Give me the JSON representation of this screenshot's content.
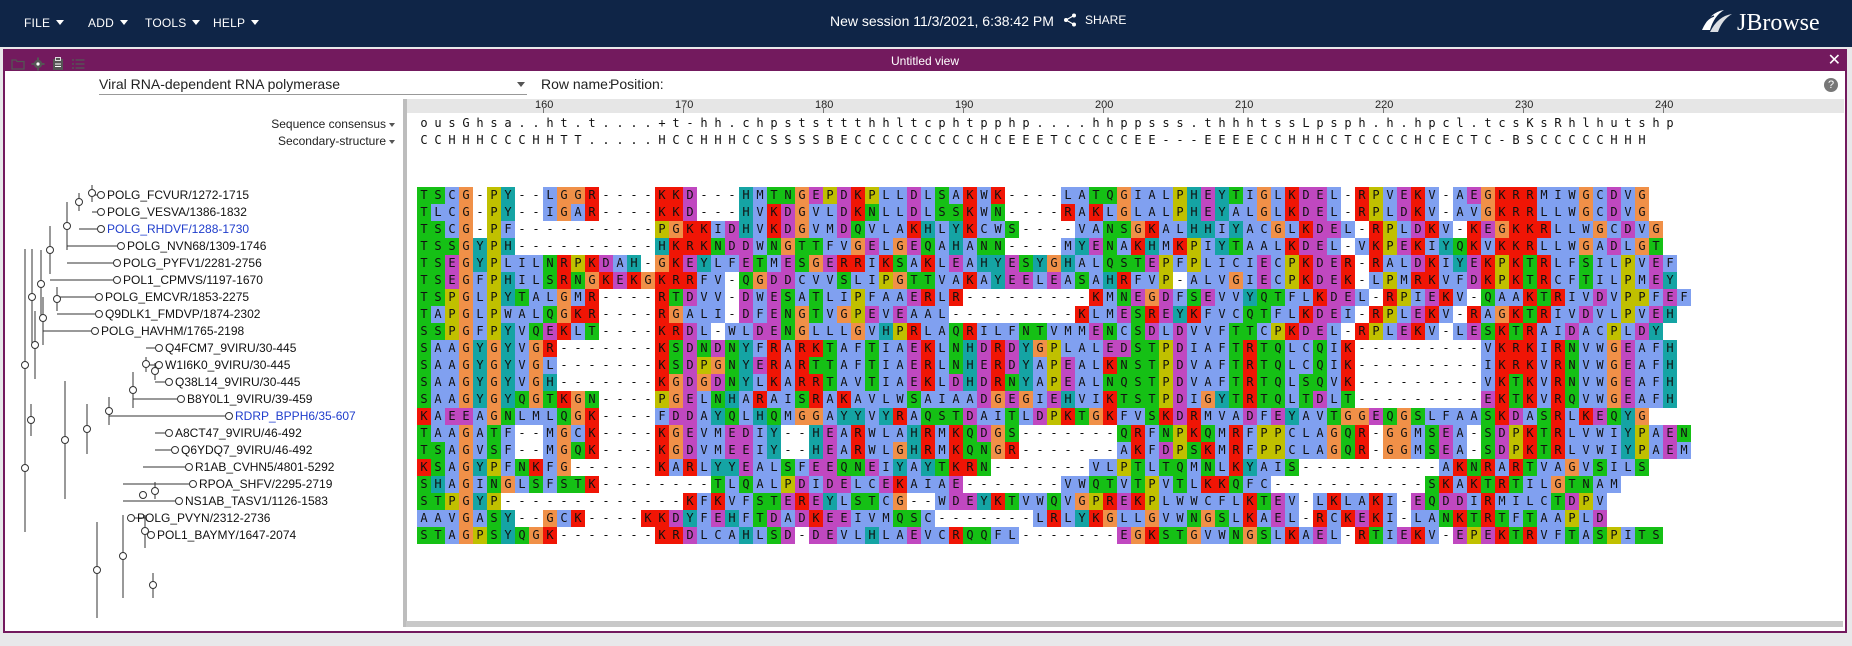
{
  "menu": [
    {
      "label": "FILE",
      "id": "file"
    },
    {
      "label": "ADD",
      "id": "add"
    },
    {
      "label": "TOOLS",
      "id": "tools"
    },
    {
      "label": "HELP",
      "id": "help"
    }
  ],
  "session": {
    "title": "New session 11/3/2021, 6:38:42 PM",
    "share_label": "SHARE"
  },
  "logo": {
    "text": "JBrowse"
  },
  "view": {
    "title": "Untitled view",
    "close": "✕",
    "dataset": "Viral RNA-dependent RNA polymerase",
    "row_name_label": "Row name:",
    "position_label": "Position:",
    "help": "?"
  },
  "ruler": {
    "ticks": [
      "160",
      "170",
      "180",
      "190",
      "200",
      "210",
      "220",
      "230",
      "240"
    ],
    "tick_columns": [
      9,
      19,
      29,
      39,
      49,
      59,
      69,
      79,
      89
    ]
  },
  "tracks": [
    {
      "name": "Sequence consensus",
      "row": "ousGhsa..ht.t....+t-hh.chpststtthhltcphtpphp....hhppsss.thhhtssLpsph.h.hpcl.tcsKsRhlhutshp"
    },
    {
      "name": "Secondary-structure",
      "row": "CCHHHCCCHHTT.....HCCHHHCCSSSSBECCCCCCCCCHCEEETCCCCCEE---EEEECCHHHCTCCCCHCECTC-BSCCCCCHHH"
    }
  ],
  "sequences": [
    {
      "name": "POLG_FCVUR/1272-1715",
      "highlight": false,
      "seq": "TSCG-PY--LGGR----KKD---HMTNGEPDKPLLDLSAKWK----LATQGIALPHEYTIGLKDEL-RPVEKV-AEGKRRMIWGCDVG"
    },
    {
      "name": "POLG_VESVA/1386-1832",
      "highlight": false,
      "seq": "TLCG-PY--IGAR----KKD---HVKDGVLDKNLLDLSSKWN----RAKLGLALPHEYALGLKDEL-RPLDKV-AVGKRRLLWGCDVG"
    },
    {
      "name": "POLG_RHDVF/1288-1730",
      "highlight": true,
      "seq": "TSCG-PF----------PGKKIDHVKDGVMDQVLAKHLYKCWS----VANSGKALHHIYACGLKDEL-RPLDKV-KEGKKRLLWGCDVG"
    },
    {
      "name": "POLG_NVN68/1309-1746",
      "highlight": false,
      "seq": "TSSGYPH----------HKRKNDDWNGTTFVGELGEQAHANN----MYENAKHMKPIYTAALKDEL-VKPEKIYQKVKKRLLWGADLGT"
    },
    {
      "name": "POLG_PYFV1/2281-2756",
      "highlight": false,
      "seq": "TSEGYPLILNRPKDAH-GKEYLFETMESGERRIKSAKLEAHYESYGHALQSTEPFPLICIECPKDER-RALDKIYEKPKTRLFSILPVEF"
    },
    {
      "name": "POL1_CPMVS/1197-1670",
      "highlight": false,
      "seq": "TSEGFPHILSRNGKEKGKRRFV-QGDDCVVSLIPGTTVAKAYEELEASAHRFVP-ALVGIECPKDEK-LPMRKVFDKPKTRCFTILPMEY"
    },
    {
      "name": "POLG_EMCVR/1853-2275",
      "highlight": false,
      "seq": "TSPGLPYTALGMR----RTDVV-DWESATLIPFAAERLR---------KMNEGDFSEVVYQTFLKDEL-RPIEKV-QAAKTRIVDVPPFEF"
    },
    {
      "name": "Q9DLK1_FMDVP/1874-2302",
      "highlight": false,
      "seq": "TAPGLPWALQGKR----RGALI-DFENGTVGPEVEAAL---------KLMESREYKFVCQTFLKDEI-RPLEKV-RAGKTRIVDVLPVEH"
    },
    {
      "name": "POLG_HAVHM/1765-2198",
      "highlight": false,
      "seq": "SSPGFPYVQEKLT----KRDL-WLDENGLLLGVHPRLAQRILFNTVMMENCSDLDVVFTTCPKDEL-RPLEKV-LESKTRAIDACPLDY"
    },
    {
      "name": "Q4FCM7_9VIRU/30-445",
      "highlight": false,
      "seq": "SAAGYGYVGR-------KSDNDNYFRARKTAFTIAEKLNHDRDYGPLALEDSTPDIAFTRTQLCQIK---------VKRKIRNVWGEAFH"
    },
    {
      "name": "W1I6K0_9VIRU/30-445",
      "highlight": false,
      "seq": "SAAGYGYVGL-------KSDPGNYERARTTAFTIAERLNHERDYAPEALKNSTPDVAFTRTQLCQIK---------IKRKVRNVWGEAFH"
    },
    {
      "name": "Q38L14_9VIRU/30-445",
      "highlight": false,
      "seq": "SAAGYGYVGH-------KGDGDNYLKARRTAVTIAEKLDHDRNYAPEALNQSTPDVAFTRTQLSQVK---------VKTKVRNVWGEAFH"
    },
    {
      "name": "B8Y0L1_9VIRU/39-459",
      "highlight": false,
      "seq": "SAAGYGYQGTKGN----PGELNHARAISRAKAVLWSAIAADGEGIEHVIKTSTPDIGYTRTQLTDLT---------EKTKVRQVWGEAFH"
    },
    {
      "name": "RDRP_BPPH6/35-607",
      "highlight": true,
      "seq": "KAEEAGNLMLQGK----FDDAYQLHQMGGAYYVYRAQSTDAITLDPKTGKFVSKDRMVADFEYAVTGGEQGSLFAASKDASRLKEQYG"
    },
    {
      "name": "A8CT47_9VIRU/46-492",
      "highlight": false,
      "seq": "TAAGATF--MGCK----KGEVMEDIY--HEARWLAHRMKQDGS-------QRFNPKQMRFPPCLAGQR-GGMSEA-SDPKTRLVWIYPAEN"
    },
    {
      "name": "Q6YDQ7_9VIRU/46-492",
      "highlight": false,
      "seq": "TSAGVSF--MGQK----KGDVMEEIY--HEARWLGHRMKQNGR-------AKFDPSKMRFPPCLAGQR-GGMSEA-SDPKTRLVWIYPAEM"
    },
    {
      "name": "R1AB_CVHN5/4801-5292",
      "highlight": false,
      "seq": "KSAGYPFNKFG------KARLYYEALSFEEQNEIYAYTKRN-------VLPTLTQMNLKYAIS----------AKNRARTVAGVSILS"
    },
    {
      "name": "RPOA_SHFV/2295-2719",
      "highlight": false,
      "seq": "SHAGINGLSFSTK--------TLQALPDIDELCEKAIAE-------VWQTVTPVTLKKQFC-----------SKAKTRTILGTNAM"
    },
    {
      "name": "NS1AB_TASV1/1126-1583",
      "highlight": false,
      "seq": "STPGYP-------------KFKVFSTEREYLSTCG--WDEYKTVWQVGPREKPLWWCFLKTEV-LKLAKI-EQDDIRMILCTDPV"
    },
    {
      "name": "POLG_PVYN/2312-2736",
      "highlight": false,
      "seq": "AAVGASY--GCK----KKDYFEHFTDADKEEIVMQSC-------LRLYKGLLGVWNGSLKAEL-RCKEKI-LANKTRTFTAAPLD"
    },
    {
      "name": "POL1_BAYMY/1647-2074",
      "highlight": false,
      "seq": "STAGPSYQGK-------KRDLCAHLSD-DEVLHLAEVCRQQFL-------EGKSTGVWNGSLKAEL-RTIEKV-EPEKTRVFTASPITS"
    }
  ],
  "palette": {
    "A": "#80a0f0",
    "I": "#80a0f0",
    "L": "#80a0f0",
    "M": "#80a0f0",
    "F": "#80a0f0",
    "W": "#80a0f0",
    "V": "#80a0f0",
    "C": "#80a0f0",
    "K": "#f01505",
    "R": "#f01505",
    "E": "#c048c0",
    "D": "#c048c0",
    "N": "#15c015",
    "Q": "#15c015",
    "S": "#15c015",
    "T": "#15c015",
    "G": "#f09048",
    "P": "#c0c000",
    "H": "#15a4a4",
    "Y": "#15a4a4"
  }
}
